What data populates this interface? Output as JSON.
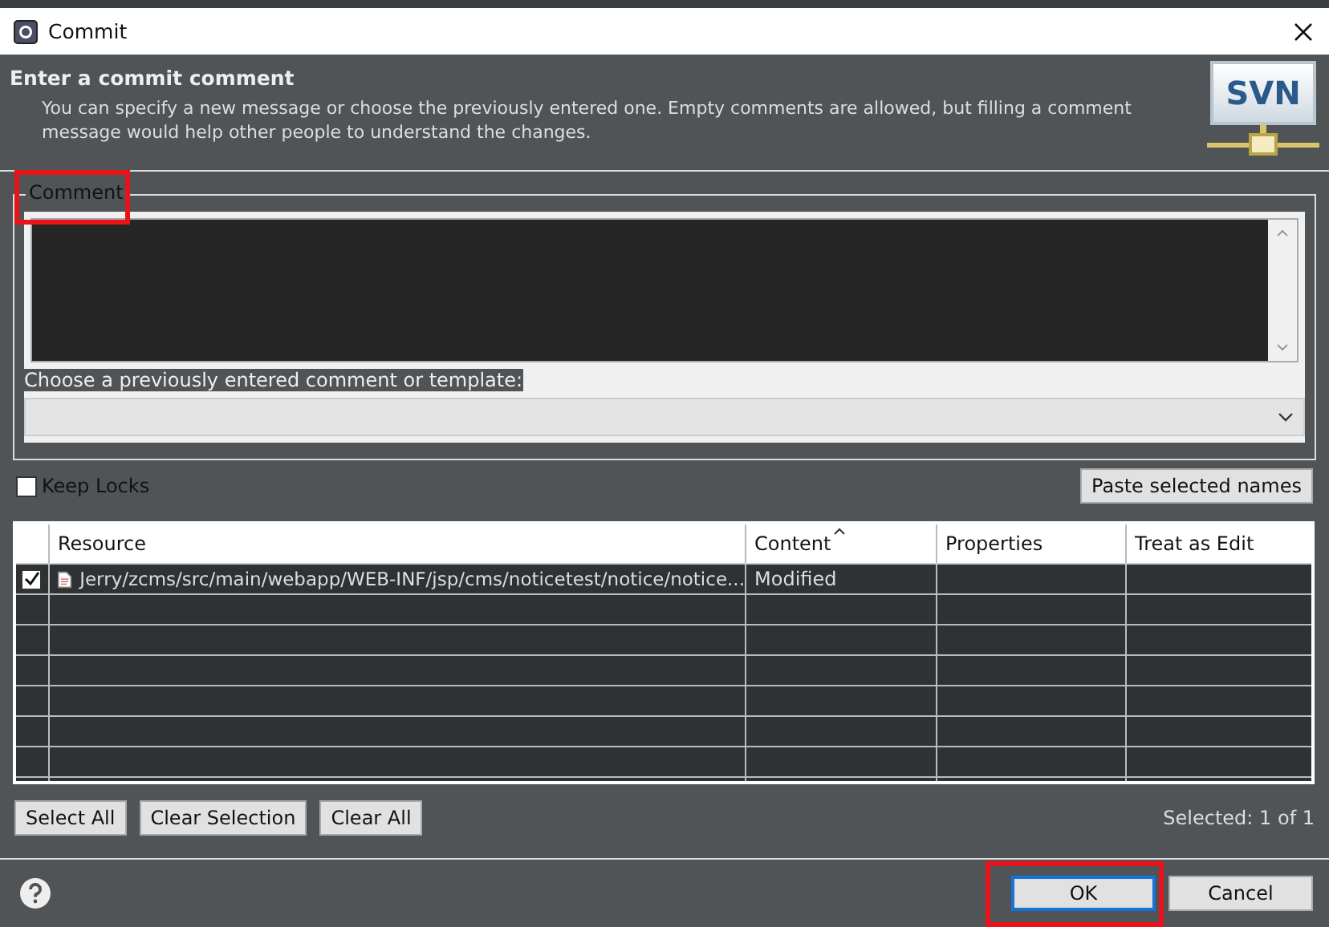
{
  "window": {
    "title": "Commit"
  },
  "header": {
    "title": "Enter a commit comment",
    "description": "You can specify a new message or choose the previously entered one. Empty comments are allowed, but filling a comment message would help other people to understand the changes.",
    "logo": "SVN"
  },
  "comment": {
    "group_label": "Comment",
    "template_label": "Choose a previously entered comment or template:"
  },
  "keep_locks": {
    "label": "Keep Locks",
    "checked": false
  },
  "paste_button": "Paste selected names",
  "table": {
    "columns": [
      "Resource",
      "Content",
      "Properties",
      "Treat as Edit"
    ],
    "rows": [
      {
        "checked": true,
        "resource": "Jerry/zcms/src/main/webapp/WEB-INF/jsp/cms/noticetest/notice/notice...",
        "content": "Modified"
      }
    ]
  },
  "selection_buttons": [
    "Select All",
    "Clear Selection",
    "Clear All"
  ],
  "selected_count": "Selected: 1 of 1",
  "footer_buttons": [
    {
      "label": "OK",
      "default": true
    },
    {
      "label": "Cancel",
      "default": false
    }
  ]
}
